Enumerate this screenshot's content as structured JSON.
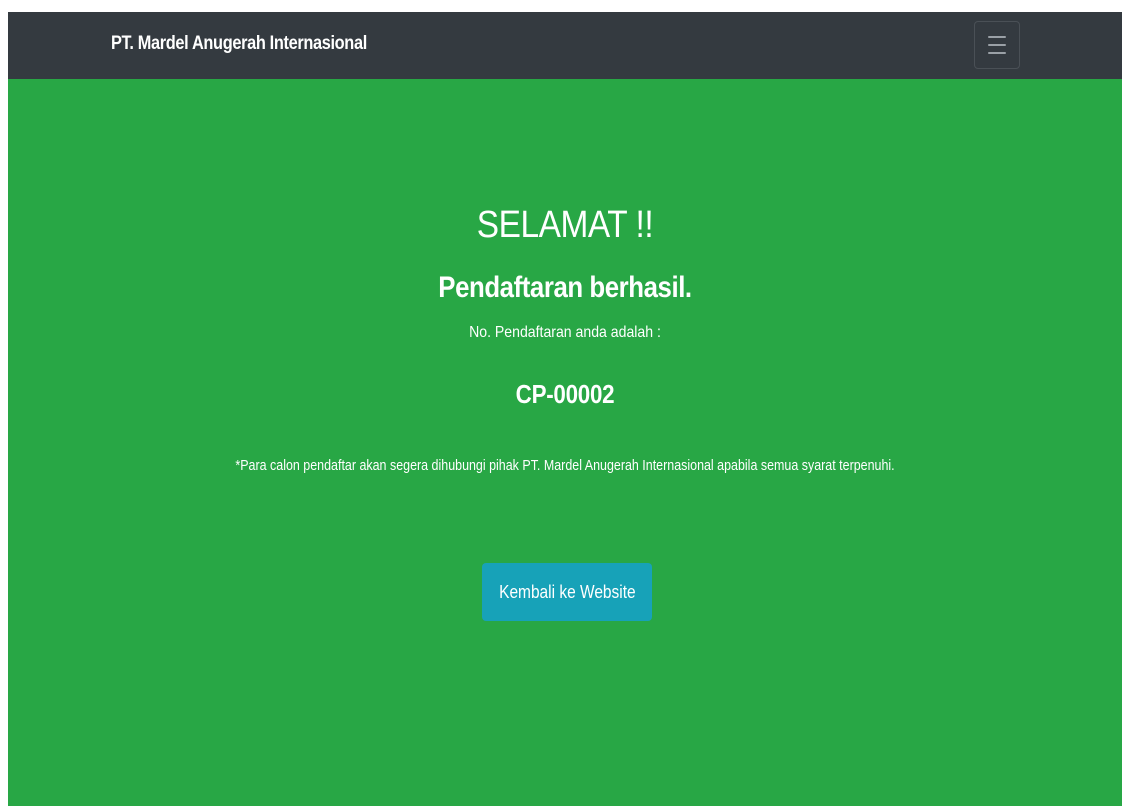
{
  "navbar": {
    "brand": "PT. Mardel Anugerah Internasional",
    "toggler_icon": "hamburger-menu-icon"
  },
  "main": {
    "heading": "SELAMAT !!",
    "subheading": "Pendaftaran berhasil.",
    "registration_label": "No. Pendaftaran anda adalah :",
    "registration_number": "CP-00002",
    "note": "*Para calon pendaftar akan segera dihubungi pihak PT. Mardel Anugerah Internasional apabila semua syarat terpenuhi.",
    "back_button_label": "Kembali ke Website"
  },
  "colors": {
    "navbar_bg": "#343a40",
    "page_bg": "#28a745",
    "button_bg": "#17a2b8",
    "text": "#ffffff"
  }
}
